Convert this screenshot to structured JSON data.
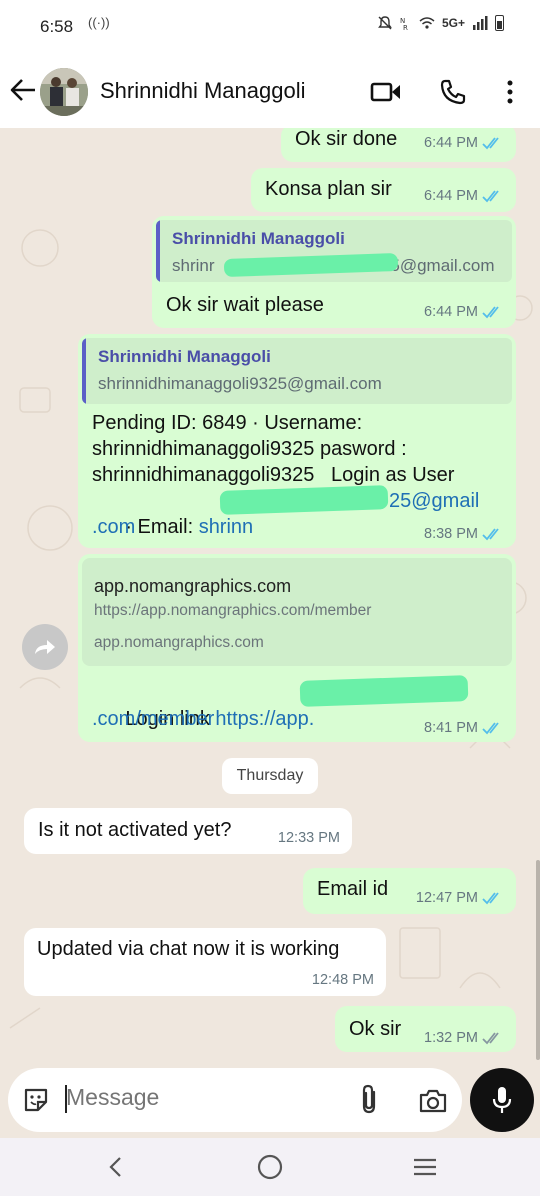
{
  "status_bar": {
    "time": "6:58",
    "hotspot_glyph": "((·))",
    "network": "5G+"
  },
  "header": {
    "contact_name": "Shrinnidhi Managgoli"
  },
  "messages": [
    {
      "text": "Ok sir done",
      "time": "6:44 PM"
    },
    {
      "text": "Konsa plan sir",
      "time": "6:44 PM"
    },
    {
      "quote_name": "Shrinnidhi Managgoli",
      "quote_text_start": "shrinr",
      "quote_text_end": "9325@gmail.com",
      "text": "Ok sir wait please",
      "time": "6:44 PM"
    },
    {
      "quote_name": "Shrinnidhi Managgoli",
      "quote_text": "shrinnidhimanaggoli9325@gmail.com",
      "line1": "Pending ID: 6849 · Username:",
      "line2": "shrinnidhimanaggoli9325 pasword :",
      "line3": "shrinnidhimanaggoli9325   Login as User",
      "line4_prefix": "· Email: ",
      "line4_link_start": "shrinn",
      "line4_link_end": "25@gmail",
      "line5_link": ".com",
      "time": "8:38 PM"
    },
    {
      "preview_title": "app.nomangraphics.com",
      "preview_url": "https://app.nomangraphics.com/member",
      "preview_domain": "app.nomangraphics.com",
      "text_prefix": "Login link ",
      "link_start": "https://app.",
      "link_end": ".com/member",
      "time": "8:41 PM"
    }
  ],
  "day_divider": "Thursday",
  "later_messages": [
    {
      "text": "Is it not activated yet?",
      "time": "12:33 PM"
    },
    {
      "text": "Email id",
      "time": "12:47 PM"
    },
    {
      "text": "Updated via chat now it is working",
      "time": "12:48 PM"
    },
    {
      "text": "Ok sir",
      "time": "1:32 PM"
    }
  ],
  "composer": {
    "placeholder": "Message"
  },
  "colors": {
    "outgoing_bubble": "#d9fdd3",
    "incoming_bubble": "#ffffff",
    "read_tick": "#53bdeb",
    "delivered_tick": "#8696a0",
    "wallpaper": "#efe7de"
  }
}
